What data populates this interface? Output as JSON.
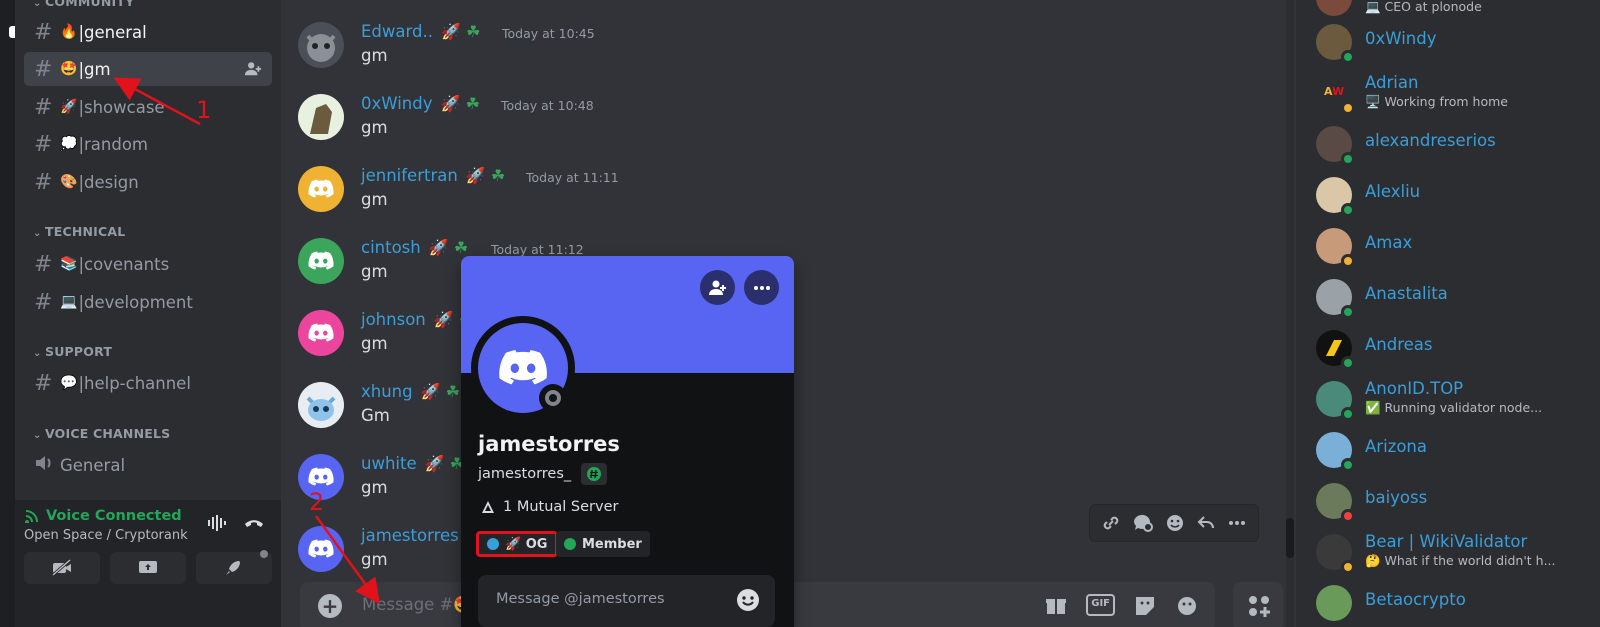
{
  "sidebar": {
    "community_label": "COMMUNITY",
    "channels_top": [
      {
        "emoji": "🔥",
        "name": "|general"
      },
      {
        "emoji": "🤩",
        "name": "|gm"
      },
      {
        "emoji": "🚀",
        "name": "|showcase"
      },
      {
        "emoji": "💭",
        "name": "|random"
      },
      {
        "emoji": "🎨",
        "name": "|design"
      }
    ],
    "technical_label": "TECHNICAL",
    "channels_technical": [
      {
        "emoji": "📚",
        "name": "|covenants"
      },
      {
        "emoji": "💻",
        "name": "|development"
      }
    ],
    "support_label": "SUPPORT",
    "channels_support": [
      {
        "emoji": "💬",
        "name": "|help-channel"
      }
    ],
    "voice_label": "VOICE CHANNELS",
    "voice_channels": [
      {
        "name": "General"
      }
    ],
    "voice_panel": {
      "status": "Voice Connected",
      "location": "Open Space / Cryptorank"
    }
  },
  "messages": [
    {
      "user": "Edward..",
      "time": "Today at 10:45",
      "text": "gm",
      "avatar_color": "#4a4f58"
    },
    {
      "user": "0xWindy",
      "time": "Today at 10:48",
      "text": "gm",
      "avatar_color": "#6b5a3e"
    },
    {
      "user": "jennifertran",
      "time": "Today at 11:11",
      "text": "gm",
      "avatar_color": "#f0b232"
    },
    {
      "user": "cintosh",
      "time": "Today at 11:12",
      "text": "gm",
      "avatar_color": "#3ba55c"
    },
    {
      "user": "johnson",
      "time": "",
      "text": "gm",
      "avatar_color": "#eb459e"
    },
    {
      "user": "xhung",
      "time": "",
      "text": "Gm",
      "avatar_color": "#e7edf3"
    },
    {
      "user": "uwhite",
      "time": "",
      "text": "gm",
      "avatar_color": "#5865f2"
    },
    {
      "user": "jamestorres",
      "time": "",
      "text": "gm",
      "avatar_color": "#5865f2"
    }
  ],
  "composer": {
    "placeholder": "Message #🤩",
    "gif_label": "GIF"
  },
  "profile": {
    "display_name": "jamestorres",
    "username": "jamestorres_",
    "mutual": "1 Mutual Server",
    "roles": [
      {
        "name": "🚀 OG",
        "color": "#3a9ed9"
      },
      {
        "name": "Member",
        "color": "#23a55a"
      }
    ],
    "message_placeholder": "Message @jamestorres"
  },
  "members": [
    {
      "name": "",
      "status": "💻 CEO at plonode",
      "avatar_color": "#7a4b3c",
      "presence": "#23a55a"
    },
    {
      "name": "0xWindy",
      "status": "",
      "avatar_color": "#6b5a3e",
      "presence": "#23a55a"
    },
    {
      "name": "Adrian",
      "status": "🖥️ Working from home",
      "avatar_color": "#ffffff",
      "presence": "#f0b232"
    },
    {
      "name": "alexandreserios",
      "status": "",
      "avatar_color": "#5a4a45",
      "presence": "#23a55a"
    },
    {
      "name": "Alexliu",
      "status": "",
      "avatar_color": "#d9c7a8",
      "presence": "#23a55a"
    },
    {
      "name": "Amax",
      "status": "",
      "avatar_color": "#c79a7a",
      "presence": "#f0b232"
    },
    {
      "name": "Anastalita",
      "status": "",
      "avatar_color": "#9aa2a8",
      "presence": "#23a55a"
    },
    {
      "name": "Andreas",
      "status": "",
      "avatar_color": "#f5c518",
      "presence": "#23a55a"
    },
    {
      "name": "AnonID.TOP",
      "status": "✅ Running validator node...",
      "avatar_color": "#4a8a7a",
      "presence": "#23a55a"
    },
    {
      "name": "Arizona",
      "status": "",
      "avatar_color": "#7ab0d8",
      "presence": "#23a55a"
    },
    {
      "name": "baiyoss",
      "status": "",
      "avatar_color": "#6a7a5a",
      "presence": "#f23f43"
    },
    {
      "name": "Bear | WikiValidator",
      "status": "🤔 What if the world didn't h...",
      "avatar_color": "#3a3a3a",
      "presence": "#f0b232"
    },
    {
      "name": "Betaocrypto",
      "status": "",
      "avatar_color": "#6a9a5a",
      "presence": "#23a55a"
    }
  ],
  "annotations": {
    "one": "1",
    "two": "2",
    "color": "#e0121b"
  },
  "colors": {
    "blurple": "#5865f2",
    "online": "#23a55a",
    "username": "#3a9ed9"
  }
}
